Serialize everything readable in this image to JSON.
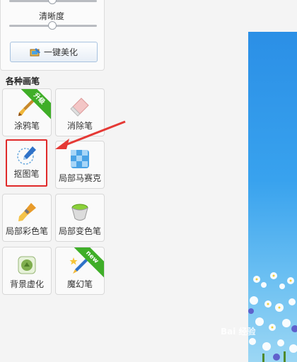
{
  "adjust": {
    "clarity_label": "清晰度",
    "one_click_label": "一键美化"
  },
  "brushes": {
    "section_title": "各种画笔",
    "items": [
      {
        "label": "涂鸦笔",
        "badge": "升级"
      },
      {
        "label": "消除笔"
      },
      {
        "label": "抠图笔"
      },
      {
        "label": "局部马赛克"
      },
      {
        "label": "局部彩色笔"
      },
      {
        "label": "局部变色笔"
      },
      {
        "label": "背景虚化"
      },
      {
        "label": "魔幻笔",
        "badge": "new"
      }
    ]
  },
  "watermark": "Bai 经验",
  "colors": {
    "highlight": "#e02a2a",
    "arrow": "#e53935",
    "badge": "#3fae28",
    "canvas": "#2b8fe6"
  }
}
